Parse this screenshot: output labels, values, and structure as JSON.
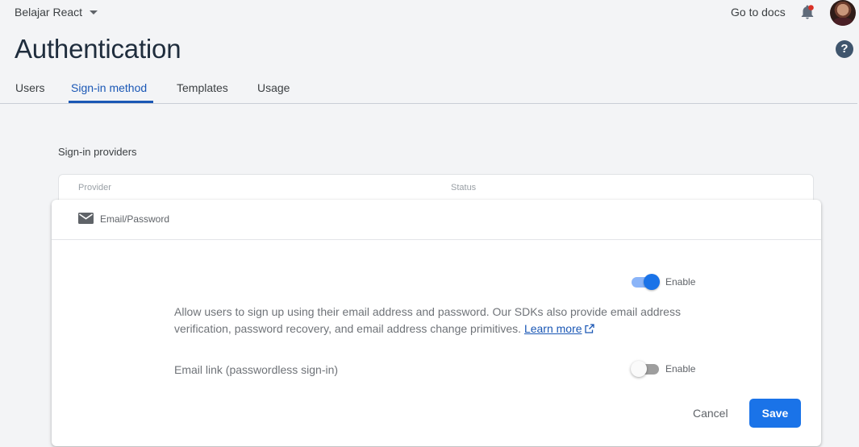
{
  "header": {
    "project_name": "Belajar React",
    "docs_link": "Go to docs",
    "bell_icon": "notifications-bell-icon",
    "help_symbol": "?"
  },
  "page": {
    "title": "Authentication"
  },
  "tabs": [
    {
      "label": "Users",
      "active": false
    },
    {
      "label": "Sign-in method",
      "active": true
    },
    {
      "label": "Templates",
      "active": false
    },
    {
      "label": "Usage",
      "active": false
    }
  ],
  "providers": {
    "section_title": "Sign-in providers",
    "columns": [
      "Provider",
      "Status"
    ]
  },
  "email_password": {
    "provider_name": "Email/Password",
    "icon": "mail-icon",
    "enable_label": "Enable",
    "enabled": true,
    "description": "Allow users to sign up using their email address and password. Our SDKs also provide email address verification, password recovery, and email address change primitives.",
    "learn_more": "Learn more",
    "email_link_label": "Email link (passwordless sign-in)",
    "email_link_enable_label": "Enable",
    "email_link_enabled": false,
    "cancel_label": "Cancel",
    "save_label": "Save"
  },
  "colors": {
    "accent": "#1a73e8",
    "link": "#1a57b5",
    "background": "#f3f4f6"
  }
}
